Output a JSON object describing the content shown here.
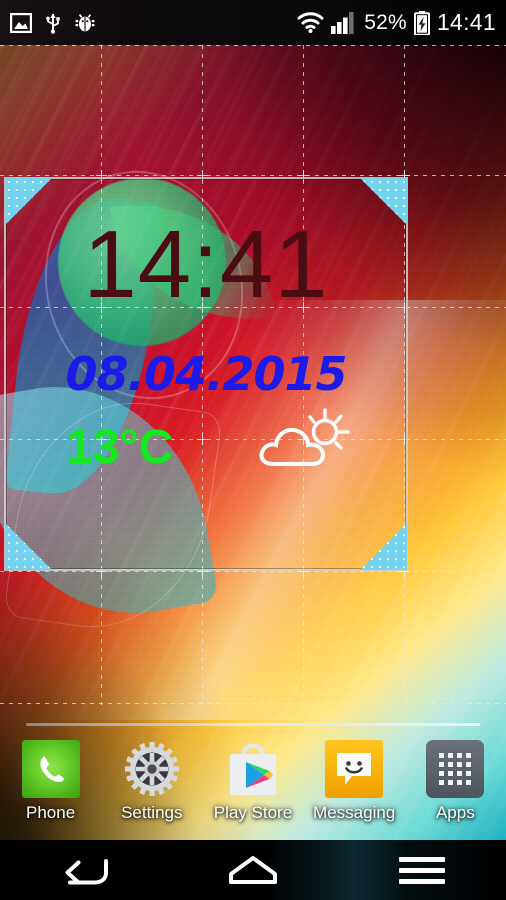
{
  "statusbar": {
    "left_icons": [
      {
        "name": "image-icon",
        "label": "Screenshot captured"
      },
      {
        "name": "usb-icon",
        "label": "USB connected"
      },
      {
        "name": "bug-icon",
        "label": "USB debugging connected"
      }
    ],
    "right_icons": [
      {
        "name": "wifi-icon",
        "label": "Wi-Fi"
      },
      {
        "name": "signal-bars-icon",
        "label": "Mobile signal",
        "bars_filled": 3,
        "bars_total": 4
      },
      {
        "name": "battery-charging-icon",
        "label": "Battery charging"
      }
    ],
    "battery_percent": "52%",
    "clock": "14:41"
  },
  "widget": {
    "name": "clock-weather-widget",
    "selected": true,
    "time": "14:41",
    "date": "08.04.2015",
    "temperature": "13°C",
    "weather_icon": "partly-cloudy-icon",
    "colors": {
      "time": "#4a0d13",
      "date": "#1b1ae8",
      "temperature": "#14e81e",
      "selection_border": "#cdd2d4",
      "resize_handle": "#74d3ef"
    }
  },
  "grid": {
    "visible": true,
    "columns": 5,
    "rows": 6,
    "v_positions": [
      101,
      202,
      303,
      404
    ],
    "h_positions": [
      130,
      262,
      394,
      526,
      658
    ]
  },
  "dock": {
    "items": [
      {
        "label": "Phone",
        "icon": "phone-handset-icon",
        "color": "#5cc324"
      },
      {
        "label": "Settings",
        "icon": "gear-icon",
        "color": "#d8dade"
      },
      {
        "label": "Play Store",
        "icon": "play-store-bag-icon",
        "color": "#e8eaec"
      },
      {
        "label": "Messaging",
        "icon": "message-bubble-icon",
        "color": "#f9b10a"
      },
      {
        "label": "Apps",
        "icon": "apps-grid-icon",
        "color": "#5b616a"
      }
    ]
  },
  "navbar": {
    "buttons": [
      {
        "label": "Back",
        "icon": "back-arrow-icon"
      },
      {
        "label": "Home",
        "icon": "home-icon"
      },
      {
        "label": "Menu",
        "icon": "menu-lines-icon"
      }
    ]
  }
}
